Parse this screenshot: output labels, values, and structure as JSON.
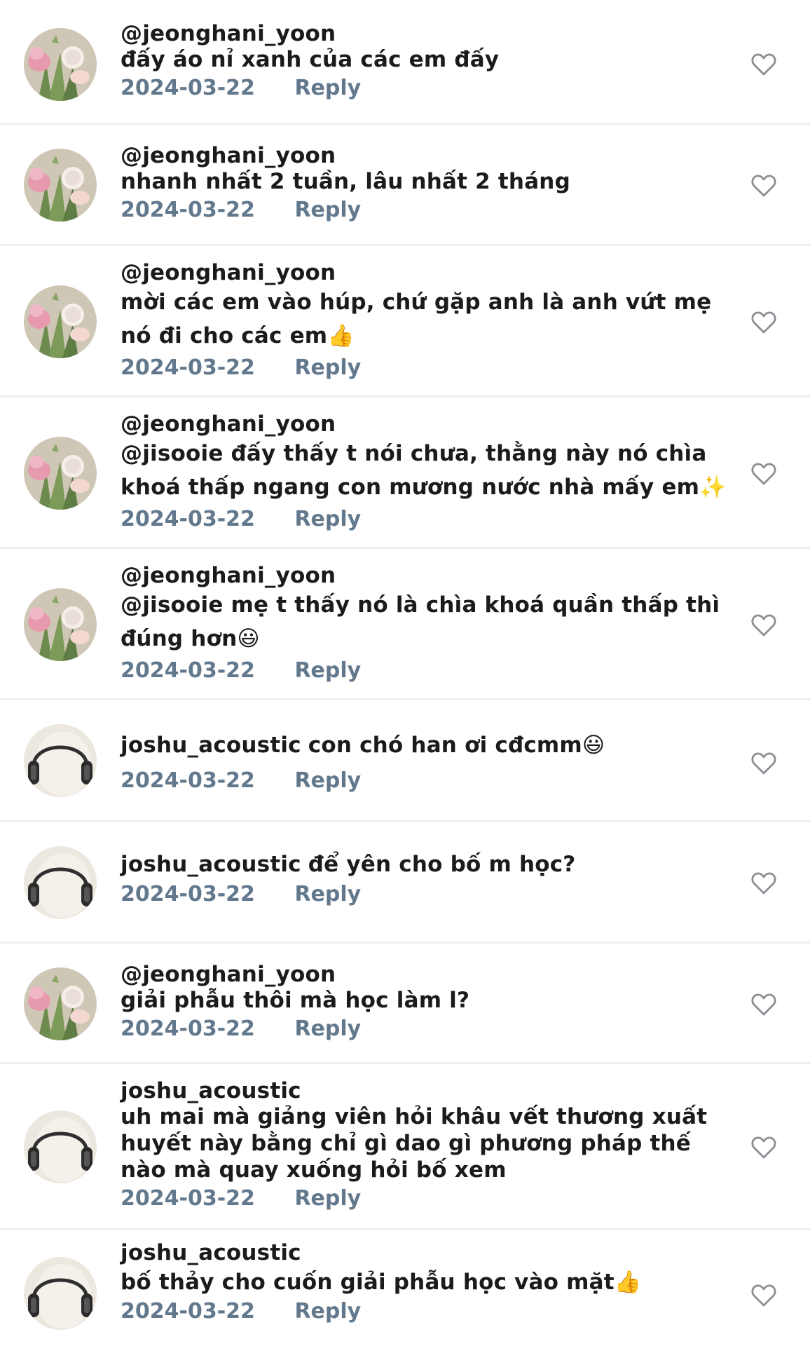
{
  "comments": [
    {
      "username": "@jeonghani_yoon",
      "text": "đấy áo nỉ xanh của các em đấy",
      "date": "2024-03-22",
      "reply": "Reply",
      "avatar": "flowers"
    },
    {
      "username": "@jeonghani_yoon",
      "text": "nhanh nhất 2 tuần, lâu nhất 2 tháng",
      "date": "2024-03-22",
      "reply": "Reply",
      "avatar": "flowers"
    },
    {
      "username": "@jeonghani_yoon",
      "text": "mời các em vào húp, chứ gặp anh là anh vứt mẹ nó đi cho các em👍",
      "date": "2024-03-22",
      "reply": "Reply",
      "avatar": "flowers"
    },
    {
      "username": "@jeonghani_yoon",
      "text": "@jisooie đấy thấy t nói chưa, thằng này nó chìa khoá thấp ngang con mương nước nhà mấy em✨",
      "date": "2024-03-22",
      "reply": "Reply",
      "avatar": "flowers"
    },
    {
      "username": "@jeonghani_yoon",
      "text": "@jisooie mẹ t thấy nó là chìa khoá quần thấp thì đúng hơn😃",
      "date": "2024-03-22",
      "reply": "Reply",
      "avatar": "flowers"
    },
    {
      "username": "joshu_acoustic",
      "text": "con chó han ơi cđcmm😃",
      "date": "2024-03-22",
      "reply": "Reply",
      "avatar": "headphones"
    },
    {
      "username": "joshu_acoustic",
      "text": "để yên cho bố m học?",
      "date": "2024-03-22",
      "reply": "Reply",
      "avatar": "headphones"
    },
    {
      "username": "@jeonghani_yoon",
      "text": "giải phẫu thôi mà học làm l?",
      "date": "2024-03-22",
      "reply": "Reply",
      "avatar": "flowers"
    },
    {
      "username": "joshu_acoustic",
      "text": "uh mai mà giảng viên hỏi khâu vết thương xuất huyết này bằng chỉ gì dao gì phương pháp thế nào mà quay xuống hỏi bố xem",
      "date": "2024-03-22",
      "reply": "Reply",
      "avatar": "headphones"
    },
    {
      "username": "joshu_acoustic",
      "text": "bố thảy cho cuốn giải phẫu học vào mặt👍",
      "date": "2024-03-22",
      "reply": "Reply",
      "avatar": "headphones"
    }
  ],
  "colors": {
    "username": "#1b1b1b",
    "meta": "#62788d",
    "divider": "#eceef0",
    "heart_outline": "#8a8f94"
  },
  "icons": {
    "like": "heart-outline-icon",
    "avatar_flowers": "flower-avatar-icon",
    "avatar_headphones": "headphones-avatar-icon"
  }
}
